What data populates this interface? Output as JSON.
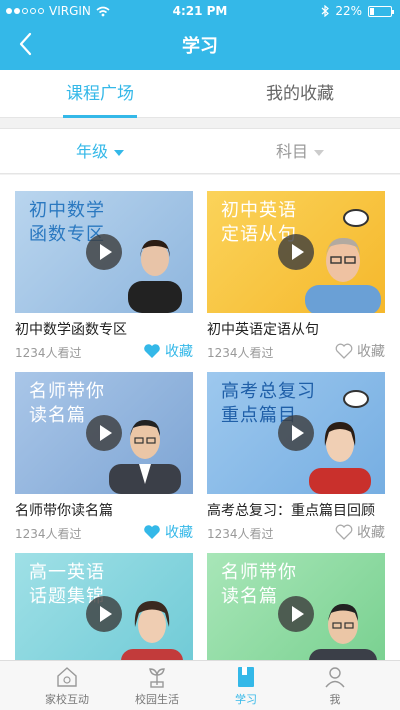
{
  "status": {
    "carrier": "VIRGIN",
    "time": "4:21 PM",
    "battery": "22%",
    "battery_level": 0.22
  },
  "nav": {
    "title": "学习"
  },
  "tabs": [
    {
      "label": "课程广场",
      "active": true
    },
    {
      "label": "我的收藏",
      "active": false
    }
  ],
  "filters": [
    {
      "label": "年级",
      "active": true
    },
    {
      "label": "科目",
      "active": false
    }
  ],
  "courses": [
    {
      "thumb_text": [
        "初中数学",
        "函数专区"
      ],
      "title": "初中数学函数专区",
      "views": "1234人看过",
      "fav_label": "收藏",
      "favorited": true
    },
    {
      "thumb_text": [
        "初中英语",
        "定语从句"
      ],
      "title": "初中英语定语从句",
      "views": "1234人看过",
      "fav_label": "收藏",
      "favorited": false
    },
    {
      "thumb_text": [
        "名师带你",
        "读名篇"
      ],
      "title": "名师带你读名篇",
      "views": "1234人看过",
      "fav_label": "收藏",
      "favorited": true
    },
    {
      "thumb_text": [
        "高考总复习",
        "重点篇目"
      ],
      "title": "高考总复习：重点篇目回顾",
      "views": "1234人看过",
      "fav_label": "收藏",
      "favorited": false
    },
    {
      "thumb_text": [
        "高一英语",
        "话题集锦"
      ],
      "title": "",
      "views": "",
      "fav_label": "",
      "favorited": false
    },
    {
      "thumb_text": [
        "名师带你",
        "读名篇"
      ],
      "title": "",
      "views": "",
      "fav_label": "",
      "favorited": false
    }
  ],
  "bottom_nav": [
    {
      "label": "家校互动",
      "icon": "house-icon",
      "active": false
    },
    {
      "label": "校园生活",
      "icon": "plant-icon",
      "active": false
    },
    {
      "label": "学习",
      "icon": "book-icon",
      "active": true
    },
    {
      "label": "我",
      "icon": "person-icon",
      "active": false
    }
  ],
  "colors": {
    "accent": "#34b8e8"
  }
}
